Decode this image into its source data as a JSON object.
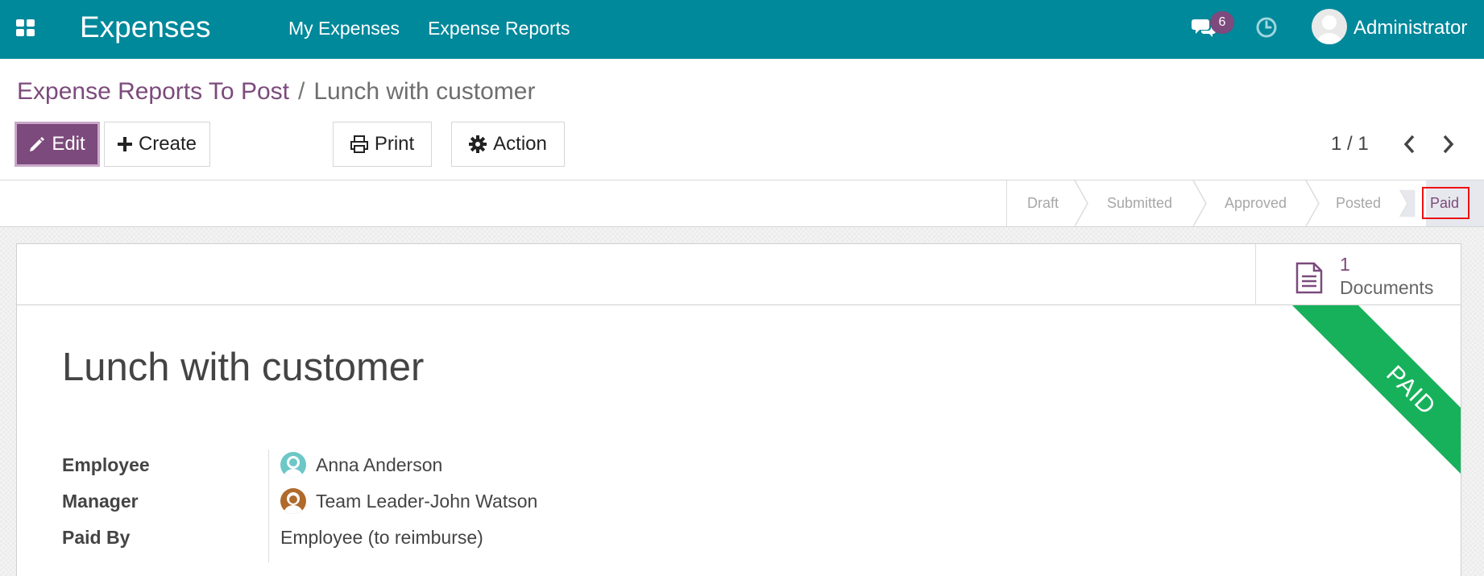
{
  "navbar": {
    "app_title": "Expenses",
    "menu": [
      "My Expenses",
      "Expense Reports"
    ],
    "notification_count": "6",
    "user_name": "Administrator",
    "color": "#00889b"
  },
  "breadcrumb": {
    "parent": "Expense Reports To Post",
    "separator": "/",
    "current": "Lunch with customer"
  },
  "toolbar": {
    "edit_label": "Edit",
    "create_label": "Create",
    "print_label": "Print",
    "action_label": "Action"
  },
  "pager": {
    "value": "1 / 1"
  },
  "statusbar": {
    "stages": [
      "Draft",
      "Submitted",
      "Approved",
      "Posted",
      "Paid"
    ],
    "active": "Paid"
  },
  "smart_button": {
    "count": "1",
    "label": "Documents"
  },
  "ribbon": {
    "text": "PAID",
    "color": "#18b15b"
  },
  "record": {
    "title": "Lunch with customer",
    "fields": [
      {
        "label": "Employee",
        "value": "Anna Anderson"
      },
      {
        "label": "Manager",
        "value": "Team Leader-John Watson"
      },
      {
        "label": "Paid By",
        "value": "Employee (to reimburse)"
      }
    ]
  },
  "accent_color": "#7c4a7c",
  "icons": [
    "apps-icon",
    "chat-icon",
    "clock-icon",
    "pencil-icon",
    "plus-icon",
    "printer-icon",
    "gear-icon",
    "chevron-left-icon",
    "chevron-right-icon",
    "document-icon"
  ]
}
